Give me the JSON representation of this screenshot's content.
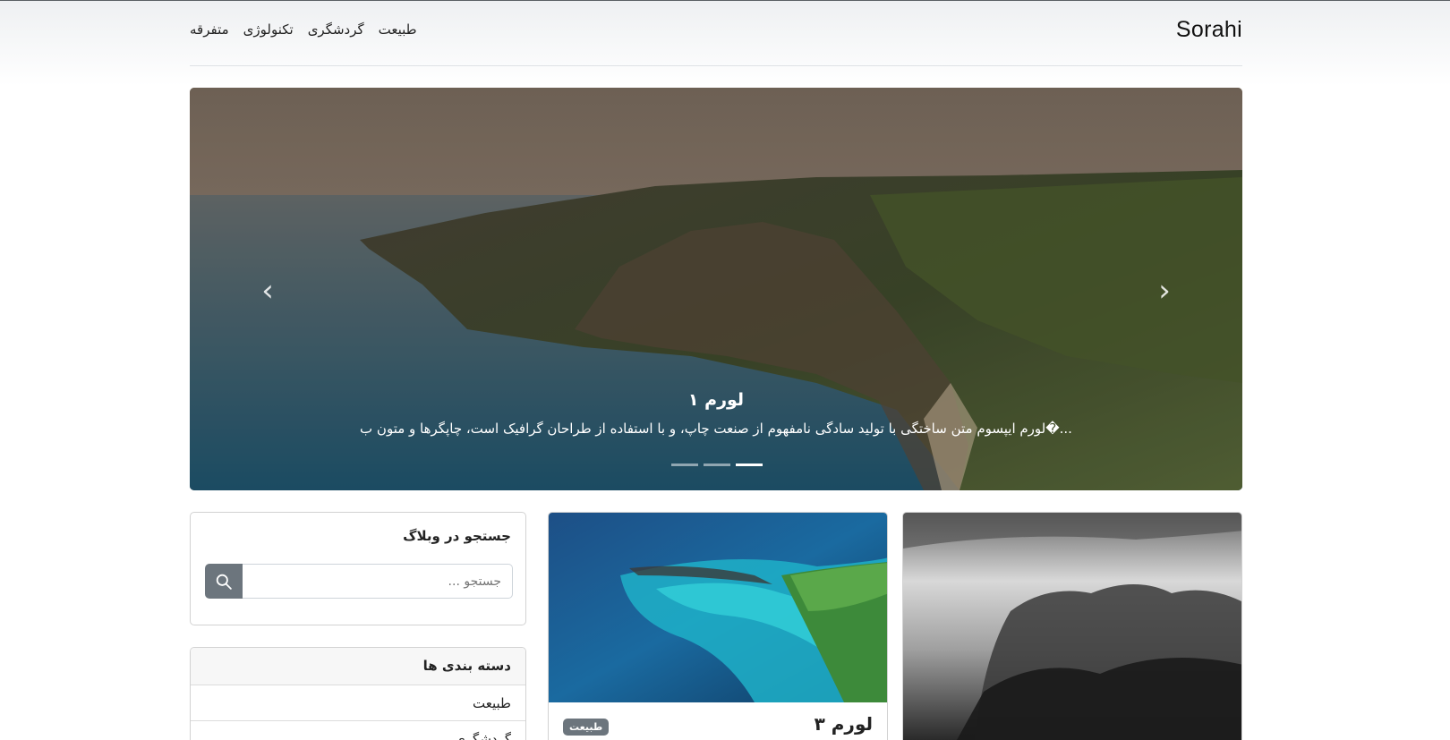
{
  "brand": "Sorahi",
  "nav": {
    "items": [
      "طبیعت",
      "گردشگری",
      "تکنولوژی",
      "متفرقه"
    ]
  },
  "hero": {
    "title": "لورم ۱",
    "text": "لورم ایپسوم متن ساختگی با تولید سادگی نامفهوم از صنعت چاپ، و با استفاده از طراحان گرافیک است، چاپگرها و متون ب�...",
    "indicator_count": 3,
    "active_indicator": 3,
    "prev_icon": "chevron-left-icon",
    "next_icon": "chevron-right-icon"
  },
  "search": {
    "title": "جستجو در وبلاگ",
    "placeholder": "جستجو ...",
    "button_icon": "search-icon"
  },
  "categories": {
    "title": "دسته بندی ها",
    "items": [
      "طبیعت",
      "گردشگری"
    ]
  },
  "posts": [
    {
      "title": "لورم ۳",
      "badge": "طبیعت"
    }
  ],
  "colors": {
    "secondary": "#6c757d",
    "border": "#dfe2e5"
  }
}
